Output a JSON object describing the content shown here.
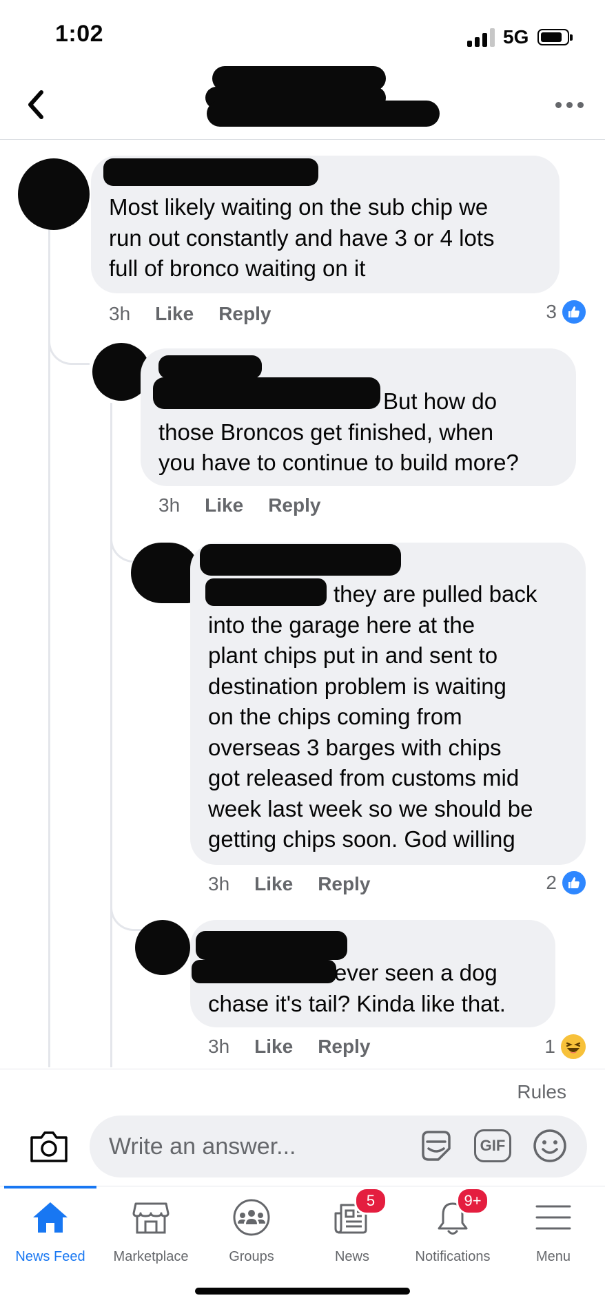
{
  "status_bar": {
    "time": "1:02",
    "network": "5G"
  },
  "comments": [
    {
      "text": "Most likely waiting on the sub chip we\nrun out constantly and have 3 or 4 lots\nfull of bronco waiting on it",
      "time": "3h",
      "like_label": "Like",
      "reply_label": "Reply",
      "reaction_count": "3",
      "reaction_icon": "like-icon"
    },
    {
      "text": "But how do\nthose Broncos get finished, when\nyou have to continue to build more?",
      "time": "3h",
      "like_label": "Like",
      "reply_label": "Reply"
    },
    {
      "text": "they are pulled back\ninto the garage here at the\nplant  chips put in and sent to\ndestination  problem is waiting\non the chips coming from\noverseas 3 barges with chips\ngot released from customs mid\nweek last week so we should be\ngetting chips soon.  God willing",
      "time": "3h",
      "like_label": "Like",
      "reply_label": "Reply",
      "reaction_count": "2",
      "reaction_icon": "like-icon"
    },
    {
      "text": "ever seen a dog\nchase it's tail? Kinda like that.",
      "time": "3h",
      "like_label": "Like",
      "reply_label": "Reply",
      "reaction_count": "1",
      "reaction_icon": "haha-icon"
    }
  ],
  "composer": {
    "rules_label": "Rules",
    "placeholder": "Write an answer...",
    "gif_label": "GIF"
  },
  "tabs": [
    {
      "label": "News Feed",
      "icon": "home-icon",
      "active": true
    },
    {
      "label": "Marketplace",
      "icon": "marketplace-icon"
    },
    {
      "label": "Groups",
      "icon": "groups-icon"
    },
    {
      "label": "News",
      "icon": "news-icon",
      "badge": "5"
    },
    {
      "label": "Notifications",
      "icon": "bell-icon",
      "badge": "9+"
    },
    {
      "label": "Menu",
      "icon": "menu-icon"
    }
  ],
  "colors": {
    "accent": "#1877f2",
    "badge": "#e41e3f",
    "bubble": "#eff0f3",
    "secondary_text": "#65676b"
  }
}
